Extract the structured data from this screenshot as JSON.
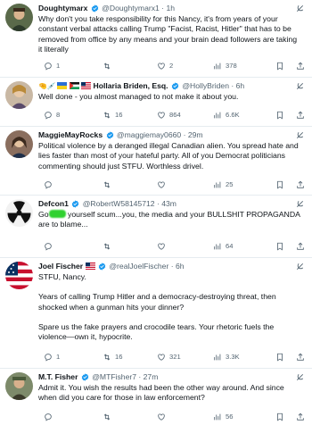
{
  "tweets": [
    {
      "name": "Doughtymarx",
      "handle": "@Doughtymarx1",
      "sep": "·",
      "time": "1h",
      "lines": [
        "Why don't you take responsibility for this Nancy, it's from years of your",
        "constant verbal attacks calling Trump \"Facist, Racist, Hitler\" that has to be",
        "removed from office by any means and your brain dead followers are taking",
        "it literally"
      ],
      "replies": "1",
      "retweets": "",
      "likes": "2",
      "views": "378"
    },
    {
      "name_emoji": "🤏💉",
      "name": "Hollaria Briden, Esq.",
      "handle": "@HollyBriden",
      "sep": "·",
      "time": "6h",
      "lines": [
        "Well done - you almost managed to not make it about you."
      ],
      "replies": "8",
      "retweets": "16",
      "likes": "864",
      "views": "6.6K"
    },
    {
      "name": "MaggieMayRocks",
      "handle": "@maggiemay0660",
      "sep": "·",
      "time": "29m",
      "lines": [
        "Political violence by a deranged illegal Canadian alien. You spread hate and",
        "lies faster than most of your hateful party. All of you Democrat politicians",
        "commenting should just STFU. Worthless drivel."
      ],
      "replies": "",
      "retweets": "",
      "likes": "",
      "views": "25"
    },
    {
      "name": "Defcon1",
      "handle": "@RobertW58145712",
      "sep": "·",
      "time": "43m",
      "line1_start": "Go",
      "line1_rest": " yourself scum...you, the media and your BULLSHIT PROPAGANDA",
      "line2": "are to blame...",
      "replies": "",
      "retweets": "",
      "likes": "",
      "views": "64"
    },
    {
      "name": "Joel Fischer",
      "handle": "@realJoelFischer",
      "sep": "·",
      "time": "6h",
      "paragraphs": [
        [
          "STFU, Nancy."
        ],
        [
          "Years of calling Trump Hitler and a democracy-destroying threat, then",
          "shocked when a gunman hits your dinner?"
        ],
        [
          "Spare us the fake prayers and crocodile tears. Your rhetoric fuels the",
          "violence—own it, hypocrite."
        ]
      ],
      "replies": "1",
      "retweets": "16",
      "likes": "321",
      "views": "3.3K"
    },
    {
      "name": "M.T. Fisher",
      "handle": "@MTFisher7",
      "sep": "·",
      "time": "27m",
      "lines": [
        "Admit it.  You wish the results had been the other way around.  And since",
        "when did you care for those in law enforcement?"
      ],
      "replies": "",
      "retweets": "",
      "likes": "",
      "views": "56"
    }
  ],
  "colors": {
    "text": "#0f1419",
    "secondary": "#536471",
    "verified": "#1d9bf0",
    "divider": "#e6ecf0",
    "censor_mark": "#2fd12f"
  },
  "icons": {
    "reply": "reply-icon",
    "retweet": "retweet-icon",
    "like": "heart-icon",
    "views": "views-icon",
    "bookmark": "bookmark-icon",
    "share": "share-icon",
    "grok": "grok-icon",
    "verified": "verified-badge-icon"
  }
}
